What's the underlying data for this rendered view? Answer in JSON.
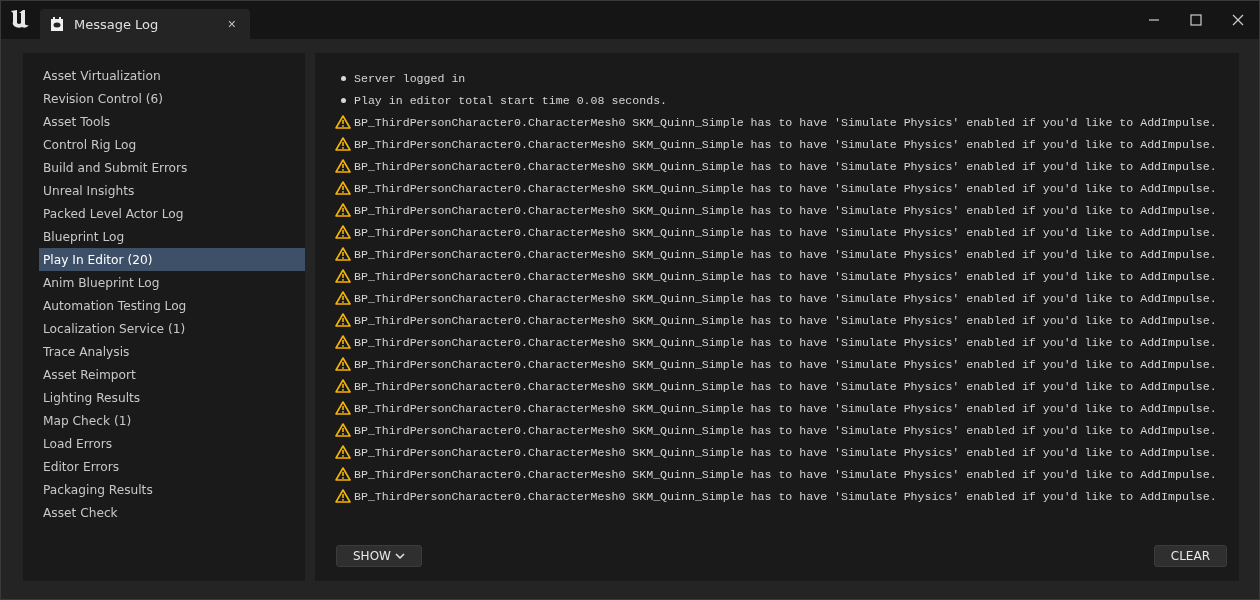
{
  "window": {
    "tab_title": "Message Log",
    "close_tab": "×"
  },
  "categories": [
    {
      "label": "Asset Virtualization",
      "selected": false
    },
    {
      "label": "Revision Control (6)",
      "selected": false
    },
    {
      "label": "Asset Tools",
      "selected": false
    },
    {
      "label": "Control Rig Log",
      "selected": false
    },
    {
      "label": "Build and Submit Errors",
      "selected": false
    },
    {
      "label": "Unreal Insights",
      "selected": false
    },
    {
      "label": "Packed Level Actor Log",
      "selected": false
    },
    {
      "label": "Blueprint Log",
      "selected": false
    },
    {
      "label": "Play In Editor (20)",
      "selected": true
    },
    {
      "label": "Anim Blueprint Log",
      "selected": false
    },
    {
      "label": "Automation Testing Log",
      "selected": false
    },
    {
      "label": "Localization Service (1)",
      "selected": false
    },
    {
      "label": "Trace Analysis",
      "selected": false
    },
    {
      "label": "Asset Reimport",
      "selected": false
    },
    {
      "label": "Lighting Results",
      "selected": false
    },
    {
      "label": "Map Check (1)",
      "selected": false
    },
    {
      "label": "Load Errors",
      "selected": false
    },
    {
      "label": "Editor Errors",
      "selected": false
    },
    {
      "label": "Packaging Results",
      "selected": false
    },
    {
      "label": "Asset Check",
      "selected": false
    }
  ],
  "messages": [
    {
      "kind": "info",
      "text": "Server logged in"
    },
    {
      "kind": "info",
      "text": "Play in editor total start time 0.08 seconds."
    },
    {
      "kind": "warning",
      "text": "BP_ThirdPersonCharacter0.CharacterMesh0 SKM_Quinn_Simple has to have 'Simulate Physics' enabled if you'd like to AddImpulse."
    },
    {
      "kind": "warning",
      "text": "BP_ThirdPersonCharacter0.CharacterMesh0 SKM_Quinn_Simple has to have 'Simulate Physics' enabled if you'd like to AddImpulse."
    },
    {
      "kind": "warning",
      "text": "BP_ThirdPersonCharacter0.CharacterMesh0 SKM_Quinn_Simple has to have 'Simulate Physics' enabled if you'd like to AddImpulse."
    },
    {
      "kind": "warning",
      "text": "BP_ThirdPersonCharacter0.CharacterMesh0 SKM_Quinn_Simple has to have 'Simulate Physics' enabled if you'd like to AddImpulse."
    },
    {
      "kind": "warning",
      "text": "BP_ThirdPersonCharacter0.CharacterMesh0 SKM_Quinn_Simple has to have 'Simulate Physics' enabled if you'd like to AddImpulse."
    },
    {
      "kind": "warning",
      "text": "BP_ThirdPersonCharacter0.CharacterMesh0 SKM_Quinn_Simple has to have 'Simulate Physics' enabled if you'd like to AddImpulse."
    },
    {
      "kind": "warning",
      "text": "BP_ThirdPersonCharacter0.CharacterMesh0 SKM_Quinn_Simple has to have 'Simulate Physics' enabled if you'd like to AddImpulse."
    },
    {
      "kind": "warning",
      "text": "BP_ThirdPersonCharacter0.CharacterMesh0 SKM_Quinn_Simple has to have 'Simulate Physics' enabled if you'd like to AddImpulse."
    },
    {
      "kind": "warning",
      "text": "BP_ThirdPersonCharacter0.CharacterMesh0 SKM_Quinn_Simple has to have 'Simulate Physics' enabled if you'd like to AddImpulse."
    },
    {
      "kind": "warning",
      "text": "BP_ThirdPersonCharacter0.CharacterMesh0 SKM_Quinn_Simple has to have 'Simulate Physics' enabled if you'd like to AddImpulse."
    },
    {
      "kind": "warning",
      "text": "BP_ThirdPersonCharacter0.CharacterMesh0 SKM_Quinn_Simple has to have 'Simulate Physics' enabled if you'd like to AddImpulse."
    },
    {
      "kind": "warning",
      "text": "BP_ThirdPersonCharacter0.CharacterMesh0 SKM_Quinn_Simple has to have 'Simulate Physics' enabled if you'd like to AddImpulse."
    },
    {
      "kind": "warning",
      "text": "BP_ThirdPersonCharacter0.CharacterMesh0 SKM_Quinn_Simple has to have 'Simulate Physics' enabled if you'd like to AddImpulse."
    },
    {
      "kind": "warning",
      "text": "BP_ThirdPersonCharacter0.CharacterMesh0 SKM_Quinn_Simple has to have 'Simulate Physics' enabled if you'd like to AddImpulse."
    },
    {
      "kind": "warning",
      "text": "BP_ThirdPersonCharacter0.CharacterMesh0 SKM_Quinn_Simple has to have 'Simulate Physics' enabled if you'd like to AddImpulse."
    },
    {
      "kind": "warning",
      "text": "BP_ThirdPersonCharacter0.CharacterMesh0 SKM_Quinn_Simple has to have 'Simulate Physics' enabled if you'd like to AddImpulse."
    },
    {
      "kind": "warning",
      "text": "BP_ThirdPersonCharacter0.CharacterMesh0 SKM_Quinn_Simple has to have 'Simulate Physics' enabled if you'd like to AddImpulse."
    },
    {
      "kind": "warning",
      "text": "BP_ThirdPersonCharacter0.CharacterMesh0 SKM_Quinn_Simple has to have 'Simulate Physics' enabled if you'd like to AddImpulse."
    }
  ],
  "footer": {
    "show_button": "SHOW",
    "clear_button": "CLEAR"
  }
}
